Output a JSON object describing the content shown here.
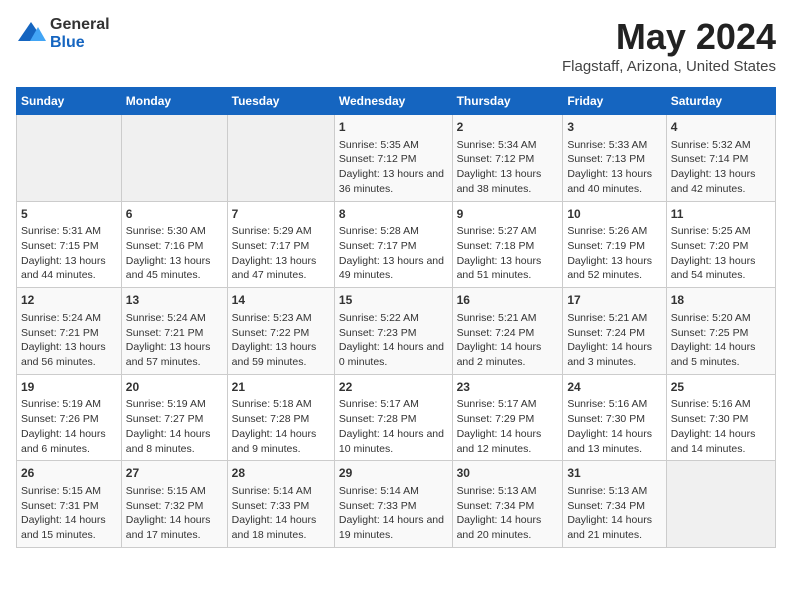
{
  "logo": {
    "general": "General",
    "blue": "Blue"
  },
  "title": "May 2024",
  "subtitle": "Flagstaff, Arizona, United States",
  "headers": [
    "Sunday",
    "Monday",
    "Tuesday",
    "Wednesday",
    "Thursday",
    "Friday",
    "Saturday"
  ],
  "weeks": [
    [
      {
        "day": "",
        "empty": true
      },
      {
        "day": "",
        "empty": true
      },
      {
        "day": "",
        "empty": true
      },
      {
        "day": "1",
        "sunrise": "Sunrise: 5:35 AM",
        "sunset": "Sunset: 7:12 PM",
        "daylight": "Daylight: 13 hours and 36 minutes."
      },
      {
        "day": "2",
        "sunrise": "Sunrise: 5:34 AM",
        "sunset": "Sunset: 7:12 PM",
        "daylight": "Daylight: 13 hours and 38 minutes."
      },
      {
        "day": "3",
        "sunrise": "Sunrise: 5:33 AM",
        "sunset": "Sunset: 7:13 PM",
        "daylight": "Daylight: 13 hours and 40 minutes."
      },
      {
        "day": "4",
        "sunrise": "Sunrise: 5:32 AM",
        "sunset": "Sunset: 7:14 PM",
        "daylight": "Daylight: 13 hours and 42 minutes."
      }
    ],
    [
      {
        "day": "5",
        "sunrise": "Sunrise: 5:31 AM",
        "sunset": "Sunset: 7:15 PM",
        "daylight": "Daylight: 13 hours and 44 minutes."
      },
      {
        "day": "6",
        "sunrise": "Sunrise: 5:30 AM",
        "sunset": "Sunset: 7:16 PM",
        "daylight": "Daylight: 13 hours and 45 minutes."
      },
      {
        "day": "7",
        "sunrise": "Sunrise: 5:29 AM",
        "sunset": "Sunset: 7:17 PM",
        "daylight": "Daylight: 13 hours and 47 minutes."
      },
      {
        "day": "8",
        "sunrise": "Sunrise: 5:28 AM",
        "sunset": "Sunset: 7:17 PM",
        "daylight": "Daylight: 13 hours and 49 minutes."
      },
      {
        "day": "9",
        "sunrise": "Sunrise: 5:27 AM",
        "sunset": "Sunset: 7:18 PM",
        "daylight": "Daylight: 13 hours and 51 minutes."
      },
      {
        "day": "10",
        "sunrise": "Sunrise: 5:26 AM",
        "sunset": "Sunset: 7:19 PM",
        "daylight": "Daylight: 13 hours and 52 minutes."
      },
      {
        "day": "11",
        "sunrise": "Sunrise: 5:25 AM",
        "sunset": "Sunset: 7:20 PM",
        "daylight": "Daylight: 13 hours and 54 minutes."
      }
    ],
    [
      {
        "day": "12",
        "sunrise": "Sunrise: 5:24 AM",
        "sunset": "Sunset: 7:21 PM",
        "daylight": "Daylight: 13 hours and 56 minutes."
      },
      {
        "day": "13",
        "sunrise": "Sunrise: 5:24 AM",
        "sunset": "Sunset: 7:21 PM",
        "daylight": "Daylight: 13 hours and 57 minutes."
      },
      {
        "day": "14",
        "sunrise": "Sunrise: 5:23 AM",
        "sunset": "Sunset: 7:22 PM",
        "daylight": "Daylight: 13 hours and 59 minutes."
      },
      {
        "day": "15",
        "sunrise": "Sunrise: 5:22 AM",
        "sunset": "Sunset: 7:23 PM",
        "daylight": "Daylight: 14 hours and 0 minutes."
      },
      {
        "day": "16",
        "sunrise": "Sunrise: 5:21 AM",
        "sunset": "Sunset: 7:24 PM",
        "daylight": "Daylight: 14 hours and 2 minutes."
      },
      {
        "day": "17",
        "sunrise": "Sunrise: 5:21 AM",
        "sunset": "Sunset: 7:24 PM",
        "daylight": "Daylight: 14 hours and 3 minutes."
      },
      {
        "day": "18",
        "sunrise": "Sunrise: 5:20 AM",
        "sunset": "Sunset: 7:25 PM",
        "daylight": "Daylight: 14 hours and 5 minutes."
      }
    ],
    [
      {
        "day": "19",
        "sunrise": "Sunrise: 5:19 AM",
        "sunset": "Sunset: 7:26 PM",
        "daylight": "Daylight: 14 hours and 6 minutes."
      },
      {
        "day": "20",
        "sunrise": "Sunrise: 5:19 AM",
        "sunset": "Sunset: 7:27 PM",
        "daylight": "Daylight: 14 hours and 8 minutes."
      },
      {
        "day": "21",
        "sunrise": "Sunrise: 5:18 AM",
        "sunset": "Sunset: 7:28 PM",
        "daylight": "Daylight: 14 hours and 9 minutes."
      },
      {
        "day": "22",
        "sunrise": "Sunrise: 5:17 AM",
        "sunset": "Sunset: 7:28 PM",
        "daylight": "Daylight: 14 hours and 10 minutes."
      },
      {
        "day": "23",
        "sunrise": "Sunrise: 5:17 AM",
        "sunset": "Sunset: 7:29 PM",
        "daylight": "Daylight: 14 hours and 12 minutes."
      },
      {
        "day": "24",
        "sunrise": "Sunrise: 5:16 AM",
        "sunset": "Sunset: 7:30 PM",
        "daylight": "Daylight: 14 hours and 13 minutes."
      },
      {
        "day": "25",
        "sunrise": "Sunrise: 5:16 AM",
        "sunset": "Sunset: 7:30 PM",
        "daylight": "Daylight: 14 hours and 14 minutes."
      }
    ],
    [
      {
        "day": "26",
        "sunrise": "Sunrise: 5:15 AM",
        "sunset": "Sunset: 7:31 PM",
        "daylight": "Daylight: 14 hours and 15 minutes."
      },
      {
        "day": "27",
        "sunrise": "Sunrise: 5:15 AM",
        "sunset": "Sunset: 7:32 PM",
        "daylight": "Daylight: 14 hours and 17 minutes."
      },
      {
        "day": "28",
        "sunrise": "Sunrise: 5:14 AM",
        "sunset": "Sunset: 7:33 PM",
        "daylight": "Daylight: 14 hours and 18 minutes."
      },
      {
        "day": "29",
        "sunrise": "Sunrise: 5:14 AM",
        "sunset": "Sunset: 7:33 PM",
        "daylight": "Daylight: 14 hours and 19 minutes."
      },
      {
        "day": "30",
        "sunrise": "Sunrise: 5:13 AM",
        "sunset": "Sunset: 7:34 PM",
        "daylight": "Daylight: 14 hours and 20 minutes."
      },
      {
        "day": "31",
        "sunrise": "Sunrise: 5:13 AM",
        "sunset": "Sunset: 7:34 PM",
        "daylight": "Daylight: 14 hours and 21 minutes."
      },
      {
        "day": "",
        "empty": true
      }
    ]
  ]
}
